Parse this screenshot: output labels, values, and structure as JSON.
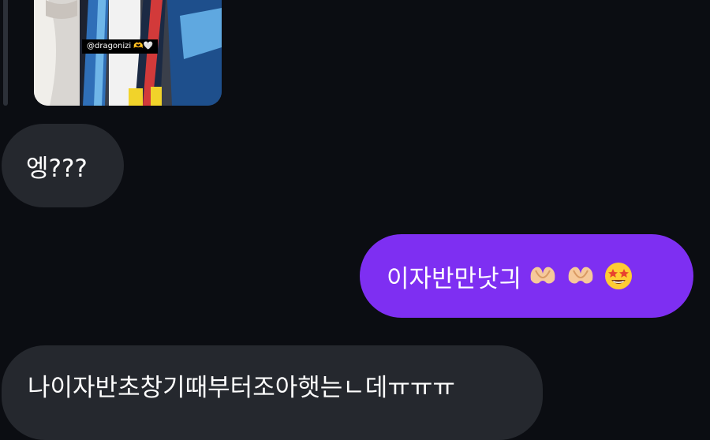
{
  "story": {
    "tag_text": "@dragonizi 🫶🤍"
  },
  "messages": [
    {
      "direction": "incoming",
      "text": "엥???"
    },
    {
      "direction": "outgoing",
      "text": "이자반만낫긔"
    },
    {
      "direction": "incoming",
      "text": "나이자반초창기때부터조아햇는ㄴ데ㅠㅠㅠ"
    }
  ],
  "colors": {
    "background": "#0b0d12",
    "incoming_bubble": "#25282e",
    "outgoing_bubble": "#7e2ff2"
  },
  "emoji_icons": [
    "heart-hands-emoji",
    "heart-hands-emoji",
    "star-struck-emoji"
  ]
}
